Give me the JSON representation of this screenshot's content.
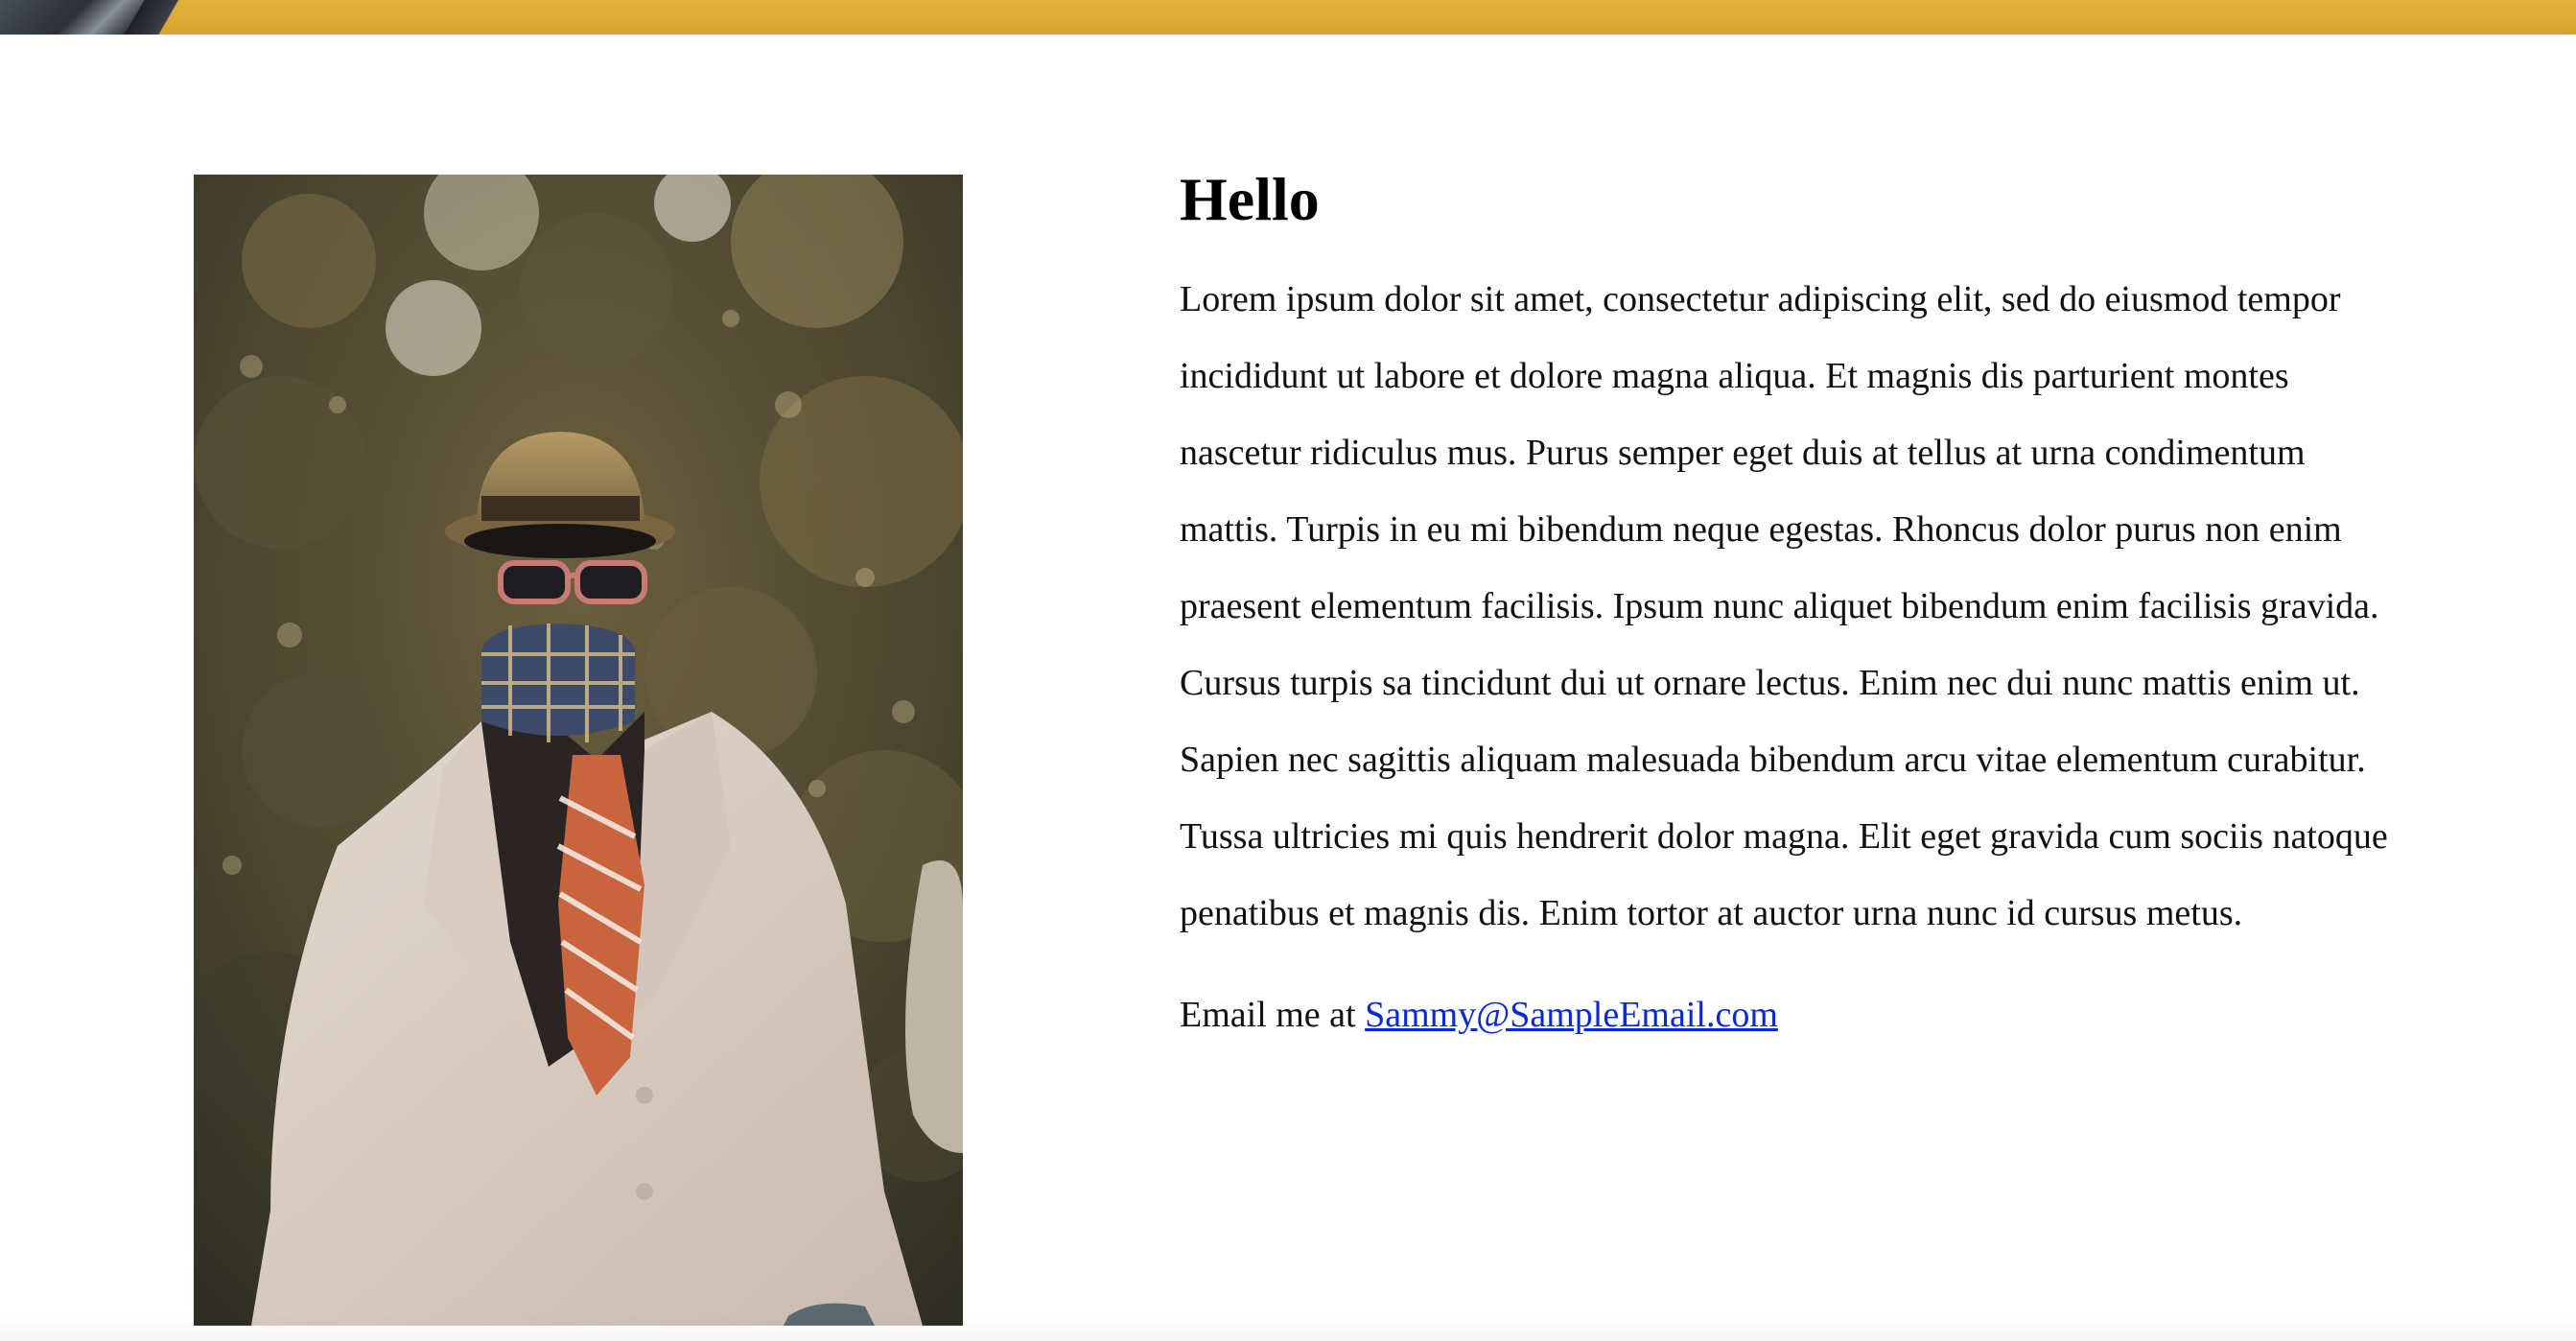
{
  "page": {
    "heading": "Hello",
    "paragraph": "Lorem ipsum dolor sit amet, consectetur adipiscing elit, sed do eiusmod tempor incididunt ut labore et dolore magna aliqua. Et magnis dis parturient montes nascetur ridiculus mus. Purus semper eget duis at tellus at urna condimentum mattis. Turpis in eu mi bibendum neque egestas. Rhoncus dolor purus non enim praesent elementum facilisis. Ipsum nunc aliquet bibendum enim facilisis gravida. Cursus turpis sa tincidunt dui ut ornare lectus. Enim nec dui nunc mattis enim ut. Sapien nec sagittis aliquam malesuada bibendum arcu vitae elementum curabitur. Tussa ultricies mi quis hendrerit dolor magna. Elit eget gravida cum sociis natoque penatibus et magnis dis. Enim tortor at auctor urna nunc id cursus metus.",
    "contact_prefix": "Email me at",
    "email_link": "Sammy@SampleEmail.com"
  },
  "colors": {
    "banner": "#deaa33",
    "link": "#0b28d8",
    "text": "#111111"
  }
}
